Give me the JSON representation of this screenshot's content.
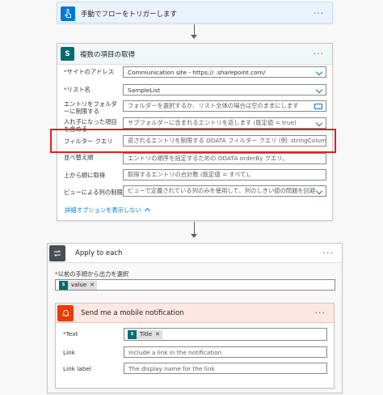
{
  "trigger": {
    "title": "手動でフローをトリガーします",
    "color": "#0078d4"
  },
  "getitems": {
    "title": "複数の項目の取得",
    "rows": [
      {
        "label": "サイトのアドレス",
        "required": true,
        "value": "Communication site - https://              .sharepoint.com/",
        "type": "dropdown"
      },
      {
        "label": "リスト名",
        "required": true,
        "value": "SampleList",
        "type": "dropdown"
      },
      {
        "label": "エントリをフォルダーに制限する",
        "required": false,
        "value": "フォルダーを選択するか、リスト全体の場合は空のままにします",
        "type": "folder"
      },
      {
        "label": "入れ子になった項目を含める",
        "required": false,
        "value": "サブフォルダーに含まれるエントリを返します (既定値 = true)",
        "type": "dropdown"
      },
      {
        "label": "フィルター クエリ",
        "required": false,
        "value": "返されるエントリを制限する ODATA フィルター クエリ (例: stringColumn eq '",
        "type": "text"
      },
      {
        "label": "並べ替え順",
        "required": false,
        "value": "エントリの順序を指定するための ODATA orderBy クエリ。",
        "type": "text"
      },
      {
        "label": "上から順に取得",
        "required": false,
        "value": "取得するエントリの合計数 (既定値 = すべて)。",
        "type": "text"
      },
      {
        "label": "ビューによる列の制限",
        "required": false,
        "value": "ビューで定義されている列のみを使用して、列のしきい値の問題を回避",
        "type": "dropdown"
      }
    ],
    "advanced_link": "詳細オプションを表示しない"
  },
  "applyeach": {
    "title": "Apply to each",
    "select_label": "以前の手順から出力を選択",
    "token": "value"
  },
  "notify": {
    "title": "Send me a mobile notification",
    "rows": [
      {
        "label": "Text",
        "required": true,
        "token": "Title"
      },
      {
        "label": "Link",
        "required": false,
        "placeholder": "Include a link in the notification"
      },
      {
        "label": "Link label",
        "required": false,
        "placeholder": "The display name for the link"
      }
    ]
  },
  "menu_glyph": "···",
  "colors": {
    "accent": "#0078d4",
    "sharepoint": "#036c70",
    "control": "#484f58",
    "notify": "#eb3c00",
    "highlight": "#e02020"
  }
}
